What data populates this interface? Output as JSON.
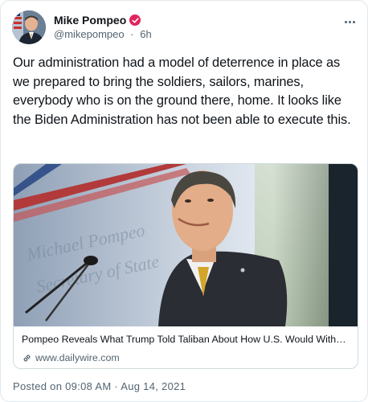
{
  "author": {
    "name": "Mike Pompeo",
    "handle": "@mikepompeo",
    "separator": "·",
    "time_ago": "6h"
  },
  "tweet": {
    "text": "Our administration had a model of deterrence in place as we prepared to bring the soldiers, sailors, marines, everybody who is on the ground there, home. It looks like the Biden Administration has not been able to execute this."
  },
  "link_card": {
    "title": "Pompeo Reveals What Trump Told Taliban About How U.S. Would Withdra...",
    "domain": "www.dailywire.com"
  },
  "footer": {
    "posted": "Posted on 09:08 AM · Aug 14, 2021"
  },
  "colors": {
    "verified_badge": "#e0245e",
    "secondary_text": "#536471",
    "border": "#cfd9de"
  },
  "icons": {
    "verified": "verified-badge-icon",
    "more": "more-dots-icon",
    "link": "link-chain-icon"
  }
}
